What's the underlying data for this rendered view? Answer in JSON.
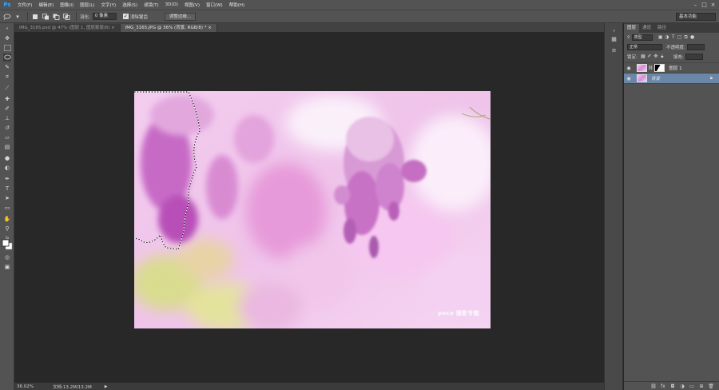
{
  "app": {
    "logo": "Ps"
  },
  "menu": [
    "文件(F)",
    "编辑(E)",
    "图像(I)",
    "图层(L)",
    "文字(Y)",
    "选择(S)",
    "滤镜(T)",
    "3D(D)",
    "视图(V)",
    "窗口(W)",
    "帮助(H)"
  ],
  "window_controls": {
    "minimize": "–",
    "maximize": "□",
    "close": "×"
  },
  "options": {
    "feather_label": "羽化:",
    "feather_value": "0 像素",
    "antialias_label": "消除锯齿",
    "refine_button": "调整边缘...",
    "workspace": "基本功能"
  },
  "tabs": [
    {
      "label": "IMG_3165.psd @ 47% (图层 1, 图层蒙版/8) ×",
      "active": false
    },
    {
      "label": "IMG_3165.JPG @ 36% (背景, RGB/8) * ×",
      "active": true
    }
  ],
  "canvas": {
    "watermark": "poco 摄影专题"
  },
  "status": {
    "zoom": "36.02%",
    "doc_info": "文档:13.2M/13.2M",
    "arrow": "▶"
  },
  "layers_panel": {
    "tabs": [
      "图层",
      "通道",
      "路径"
    ],
    "filter_kind": "类型",
    "blend_mode": "正常",
    "opacity_label": "不透明度:",
    "lock_label": "锁定:",
    "fill_label": "填充:",
    "layers": [
      {
        "name": "图层 1",
        "selected": false,
        "has_mask": true
      },
      {
        "name": "背景",
        "selected": true,
        "has_mask": false
      }
    ]
  },
  "colors": {
    "panel": "#535353",
    "canvas_bg": "#282828",
    "selection": "#6b87a8",
    "ps_blue": "#31a8ff"
  }
}
